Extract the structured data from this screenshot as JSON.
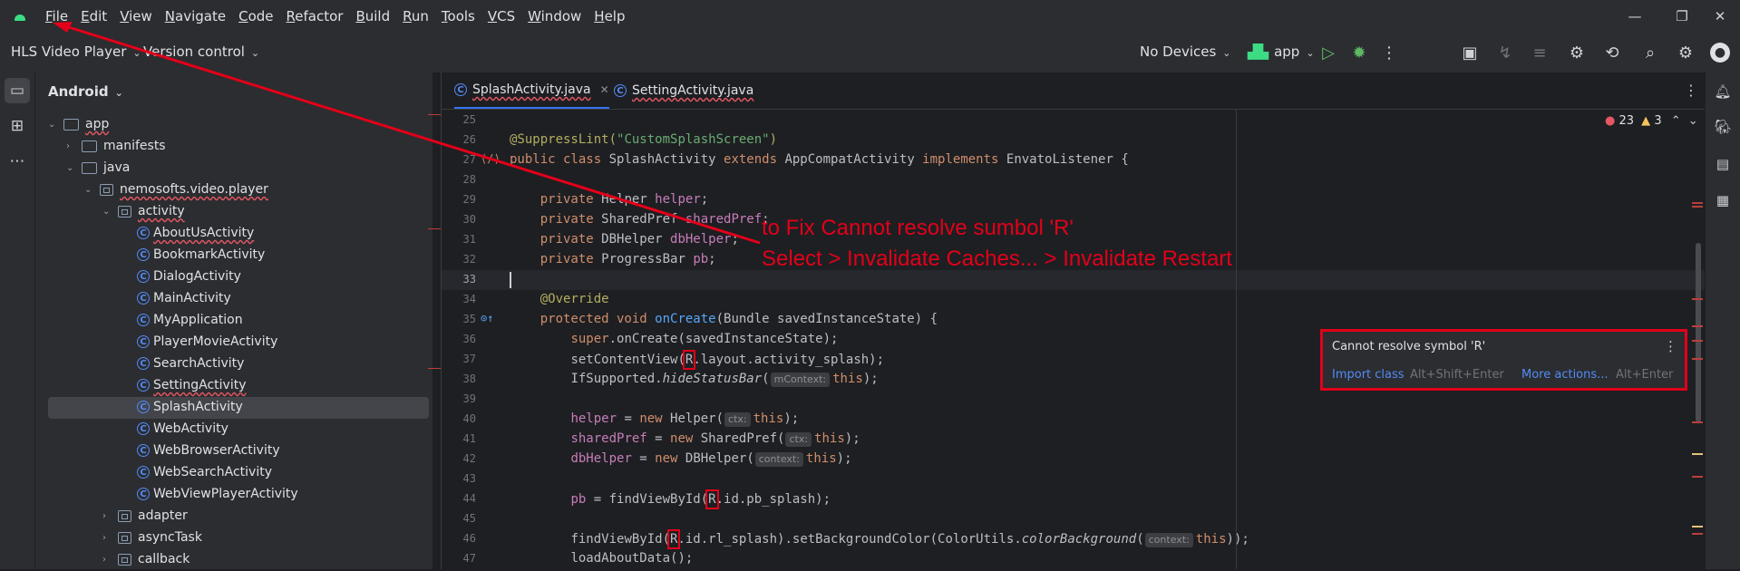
{
  "menubar": {
    "items": [
      {
        "label": "File",
        "u": "F",
        "rest": "ile"
      },
      {
        "label": "Edit",
        "u": "E",
        "rest": "dit"
      },
      {
        "label": "View",
        "u": "V",
        "rest": "iew"
      },
      {
        "label": "Navigate",
        "u": "N",
        "rest": "avigate"
      },
      {
        "label": "Code",
        "u": "C",
        "rest": "ode"
      },
      {
        "label": "Refactor",
        "u": "R",
        "rest": "efactor"
      },
      {
        "label": "Build",
        "u": "B",
        "rest": "uild"
      },
      {
        "label": "Run",
        "u": "R",
        "rest": "un"
      },
      {
        "label": "Tools",
        "u": "T",
        "rest": "ools"
      },
      {
        "label": "VCS",
        "u": "V",
        "rest": "CS"
      },
      {
        "label": "Window",
        "u": "W",
        "rest": "indow"
      },
      {
        "label": "Help",
        "u": "H",
        "rest": "elp"
      }
    ],
    "minimize": "—",
    "restore": "❐",
    "close": "✕"
  },
  "toolbar": {
    "project_name": "HLS Video Player",
    "version_control": "Version control",
    "devices": "No Devices",
    "run_config": "app"
  },
  "project_panel": {
    "title": "Android",
    "rows": [
      {
        "label": "app",
        "type": "folder",
        "depth": 0,
        "arrow": "⌄"
      },
      {
        "label": "manifests",
        "type": "folder",
        "depth": 1,
        "arrow": "›"
      },
      {
        "label": "java",
        "type": "folder",
        "depth": 1,
        "arrow": "⌄"
      },
      {
        "label": "nemosofts.video.player",
        "type": "package",
        "depth": 2,
        "arrow": "⌄"
      },
      {
        "label": "activity",
        "type": "package",
        "depth": 3,
        "arrow": "⌄"
      },
      {
        "label": "AboutUsActivity",
        "type": "class",
        "depth": 4,
        "arrow": ""
      },
      {
        "label": "BookmarkActivity",
        "type": "class",
        "depth": 4,
        "arrow": ""
      },
      {
        "label": "DialogActivity",
        "type": "class",
        "depth": 4,
        "arrow": ""
      },
      {
        "label": "MainActivity",
        "type": "class",
        "depth": 4,
        "arrow": ""
      },
      {
        "label": "MyApplication",
        "type": "class",
        "depth": 4,
        "arrow": ""
      },
      {
        "label": "PlayerMovieActivity",
        "type": "class",
        "depth": 4,
        "arrow": ""
      },
      {
        "label": "SearchActivity",
        "type": "class",
        "depth": 4,
        "arrow": ""
      },
      {
        "label": "SettingActivity",
        "type": "class",
        "depth": 4,
        "arrow": ""
      },
      {
        "label": "SplashActivity",
        "type": "class",
        "depth": 4,
        "arrow": ""
      },
      {
        "label": "WebActivity",
        "type": "class",
        "depth": 4,
        "arrow": ""
      },
      {
        "label": "WebBrowserActivity",
        "type": "class",
        "depth": 4,
        "arrow": ""
      },
      {
        "label": "WebSearchActivity",
        "type": "class",
        "depth": 4,
        "arrow": ""
      },
      {
        "label": "WebViewPlayerActivity",
        "type": "class",
        "depth": 4,
        "arrow": ""
      },
      {
        "label": "adapter",
        "type": "package",
        "depth": 3,
        "arrow": "›"
      },
      {
        "label": "asyncTask",
        "type": "package",
        "depth": 3,
        "arrow": "›"
      },
      {
        "label": "callback",
        "type": "package",
        "depth": 3,
        "arrow": "›"
      }
    ]
  },
  "editor": {
    "tabs": [
      {
        "label": "SplashActivity.java",
        "active": true
      },
      {
        "label": "SettingActivity.java",
        "active": false
      }
    ],
    "error_count": "23",
    "warning_count": "3",
    "line_numbers": [
      "25",
      "26",
      "27",
      "28",
      "29",
      "30",
      "31",
      "32",
      "33",
      "34",
      "35",
      "36",
      "37",
      "38",
      "39",
      "40",
      "41",
      "42",
      "43",
      "44",
      "45",
      "46",
      "47"
    ],
    "code": {
      "l26_ann": "@SuppressLint(",
      "l26_str": "\"CustomSplashScreen\"",
      "l26_end": ")",
      "l27_pub": "public class ",
      "l27_name": "SplashActivity ",
      "l27_ext": "extends ",
      "l27_base": "AppCompatActivity ",
      "l27_impl": "implements ",
      "l27_iface": "EnvatoListener {",
      "priv": "private ",
      "l29_type": "Helper ",
      "l29_var": "helper",
      "l30_type": "SharedPref ",
      "l30_var": "sharedPref",
      "l31_type": "DBHelper ",
      "l31_var": "dbHelper",
      "l32_type": "ProgressBar ",
      "l32_var": "pb",
      "semi": ";",
      "l34": "@Override",
      "l35_kw": "protected void ",
      "l35_fn": "onCreate",
      "l35_rest": "(Bundle savedInstanceState) {",
      "l36_super": "super",
      "l36_rest": ".onCreate(savedInstanceState);",
      "l37_a": "setContentView(",
      "R": "R",
      "l37_b": ".layout.activity_splash);",
      "l38_a": "IfSupported.",
      "l38_fn": "hideStatusBar",
      "l38_b": "(",
      "l38_hint": "mContext:",
      "this": "this",
      "close": ");",
      "l40_var": "helper",
      "l40_a": " = ",
      "new": "new ",
      "l40_b": "Helper(",
      "ctx": "ctx:",
      "l41_var": "sharedPref",
      "l41_b": "SharedPref(",
      "l42_var": "dbHelper",
      "l42_b": "DBHelper(",
      "context": "context:",
      "l44_var": "pb",
      "l44_a": " = findViewById(",
      "l44_b": ".id.pb_splash);",
      "l46_a": "findViewById(",
      "l46_b": ".id.rl_splash).setBackgroundColor(ColorUtils.",
      "l46_fn": "colorBackground",
      "l46_c": "(",
      "l46_end": "));",
      "l47": "loadAboutData();"
    }
  },
  "popup": {
    "title": "Cannot resolve symbol 'R'",
    "import_label": "Import class",
    "import_shortcut": "Alt+Shift+Enter",
    "more_label": "More actions...",
    "more_shortcut": "Alt+Enter"
  },
  "annotation": {
    "line1": "to Fix Cannot resolve sumbol 'R'",
    "line2": "Select > Invalidate Caches... > Invalidate Restart"
  },
  "colors": {
    "annotation_red": "#e2001a",
    "accent": "#3574f0"
  }
}
